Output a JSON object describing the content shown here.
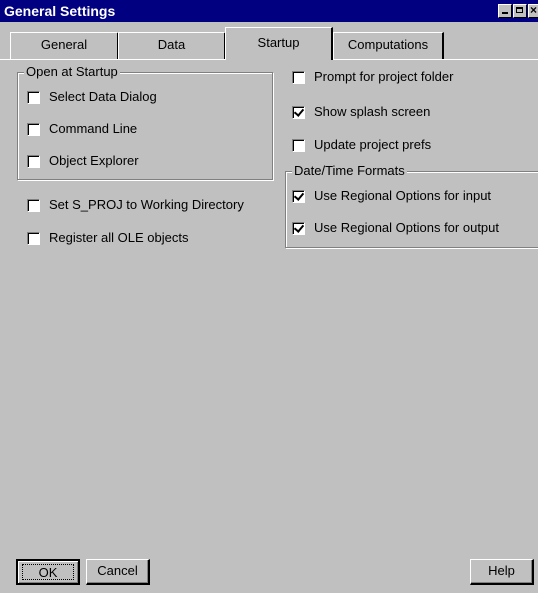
{
  "window": {
    "title": "General Settings"
  },
  "tabs": [
    {
      "label": "General",
      "active": false
    },
    {
      "label": "Data",
      "active": false
    },
    {
      "label": "Startup",
      "active": true
    },
    {
      "label": "Computations",
      "active": false
    }
  ],
  "open_at_startup": {
    "label": "Open at Startup",
    "items": [
      {
        "label": "Select Data Dialog",
        "checked": false
      },
      {
        "label": "Command Line",
        "checked": false
      },
      {
        "label": "Object Explorer",
        "checked": false
      }
    ]
  },
  "left_options": [
    {
      "label": "Set S_PROJ to Working Directory",
      "checked": false
    },
    {
      "label": "Register all OLE objects",
      "checked": false
    }
  ],
  "right_options": [
    {
      "label": "Prompt for project folder",
      "checked": false
    },
    {
      "label": "Show splash screen",
      "checked": true
    },
    {
      "label": "Update project prefs",
      "checked": false
    }
  ],
  "datetime_formats": {
    "label": "Date/Time Formats",
    "items": [
      {
        "label": "Use Regional Options for input",
        "checked": true
      },
      {
        "label": "Use Regional Options for output",
        "checked": true
      }
    ]
  },
  "buttons": {
    "ok": "OK",
    "cancel": "Cancel",
    "help": "Help"
  }
}
